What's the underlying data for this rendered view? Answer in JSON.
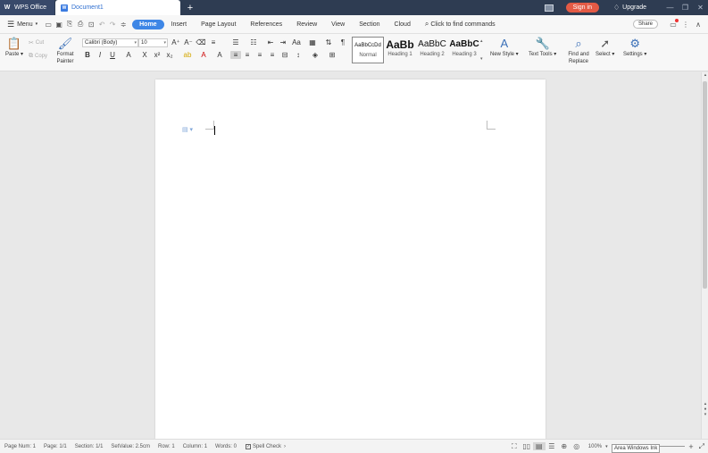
{
  "titlebar": {
    "app_tab": "WPS Office",
    "doc_tab": "Document1",
    "new_tab": "+",
    "signin": "Sign in",
    "upgrade": "Upgrade",
    "controls": [
      "—",
      "❐",
      "✕"
    ]
  },
  "menu": {
    "menu_label": "Menu",
    "tabs": [
      "Home",
      "Insert",
      "Page Layout",
      "References",
      "Review",
      "View",
      "Section",
      "Cloud"
    ],
    "active_tab": "Home",
    "find_commands": "Click to find commands",
    "share": "Share"
  },
  "ribbon": {
    "paste": "Paste",
    "cut": "Cut",
    "copy": "Copy",
    "format_painter": "Format Painter",
    "font_name": "Calibri (Body)",
    "font_size": "10",
    "styles": [
      {
        "preview": "AaBbCcDd",
        "name": "Normal"
      },
      {
        "preview": "AaBb",
        "name": "Heading 1"
      },
      {
        "preview": "AaBbC",
        "name": "Heading 2"
      },
      {
        "preview": "AaBbC",
        "name": "Heading 3"
      }
    ],
    "new_style": "New Style",
    "text_tools": "Text Tools",
    "find_replace": "Find and Replace",
    "select": "Select",
    "settings": "Settings"
  },
  "status": {
    "page_num": "Page Num: 1",
    "page": "Page: 1/1",
    "section": "Section: 1/1",
    "set_value": "SetValue: 2.5cm",
    "row": "Row: 1",
    "column": "Column: 1",
    "words": "Words: 0",
    "spell_check": "Spell Check",
    "zoom": "100%",
    "tooltip": "Area Windows Ink"
  },
  "colors": {
    "titlebar": "#2e3c52",
    "accent": "#3d86e6",
    "signin": "#e35a45"
  }
}
